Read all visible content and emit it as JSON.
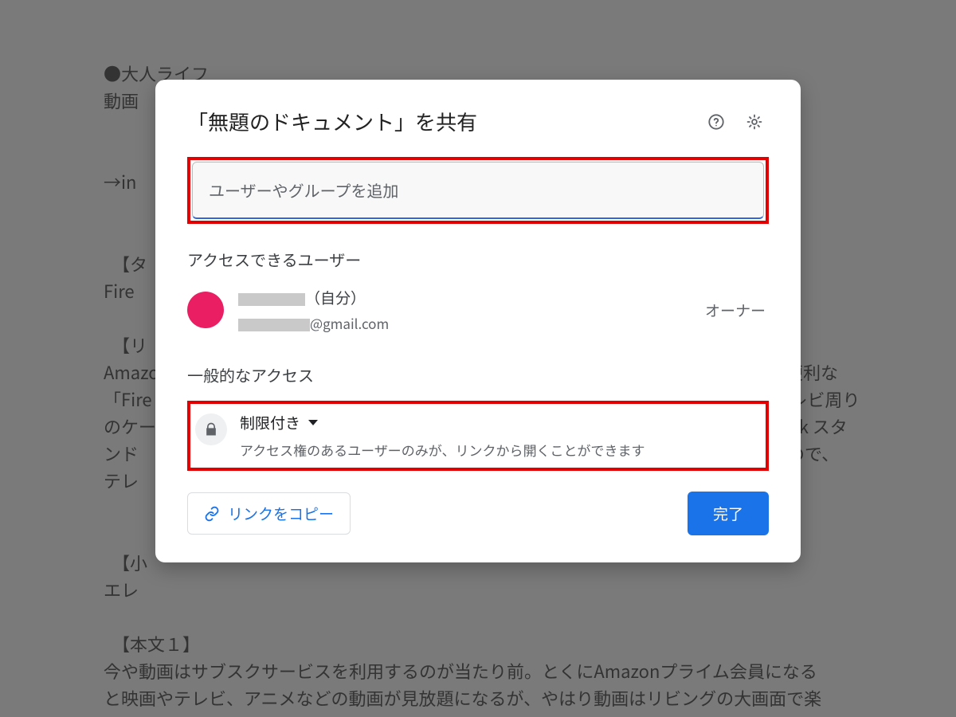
{
  "background_doc": {
    "text": "●大人ライフ\n動画\n\n\n→in\n\n\n　【タ\nFire\n\n　【リ\nAmazonプライムの動画がテレビで見られる「Fire TV Stick」　　　　　　　　　　　に便利な\n「Fire TV Stick」　　　　　　　　　　　　　　　　　　　　　　　　　　　　　　　テレビ周り\nのケーブルが　　　　　　　　　　　　　　　　　　　　　　　　　　　　　　　　Stick スタ\nンド　　　　　　　　　　　　　　　　　　　　　　　　　　　　　　　　　　　　もので、\nテレ\n\n\n　【小\nエレ\n\n　【本文１】\n今や動画はサブスクサービスを利用するのが当たり前。とくにAmazonプライム会員になる\nと映画やテレビ、アニメなどの動画が見放題になるが、やはり動画はリビングの大画面で楽"
  },
  "dialog": {
    "title": "「無題のドキュメント」を共有",
    "add_people_placeholder": "ユーザーやグループを追加",
    "access_users_label": "アクセスできるユーザー",
    "user": {
      "name_suffix": "（自分）",
      "email_domain": "@gmail.com",
      "role": "オーナー"
    },
    "general_access_label": "一般的なアクセス",
    "restricted": {
      "label": "制限付き",
      "description": "アクセス権のあるユーザーのみが、リンクから開くことができます"
    },
    "copy_link_label": "リンクをコピー",
    "done_label": "完了"
  },
  "icons": {
    "help": "help-icon",
    "settings": "gear-icon",
    "lock": "lock-icon",
    "link": "link-icon",
    "caret_down": "caret-down-icon"
  }
}
